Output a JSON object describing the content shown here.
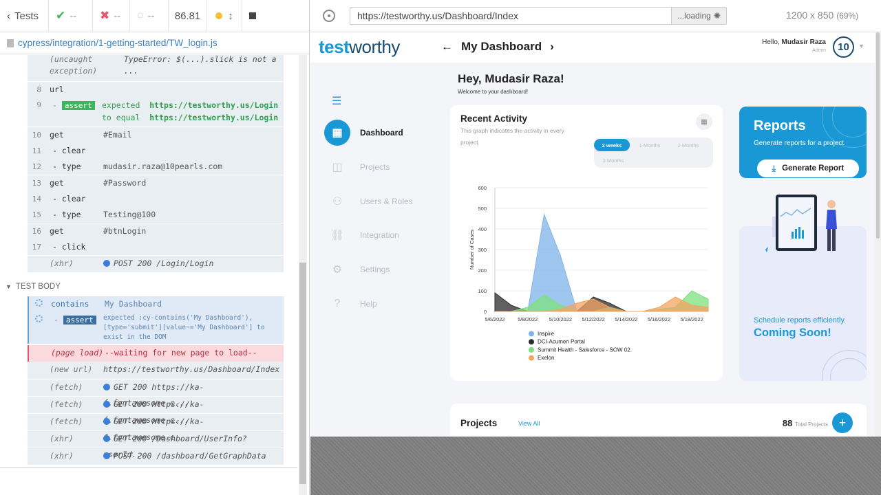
{
  "runner": {
    "tests_label": "Tests",
    "passed": "--",
    "failed": "--",
    "pending": "--",
    "duration": "86.81",
    "spec_path": "cypress/integration/1-getting-started/TW_login.js"
  },
  "commands": [
    {
      "num": "",
      "name": "(uncaught exception)",
      "msg": "TypeError: $(...).slick is not a ..."
    },
    {
      "num": "8",
      "name": "url",
      "msg": ""
    },
    {
      "num": "9",
      "name": "-assert",
      "msg_prefix": "expected",
      "msg_a": "https://testworthy.us/Login",
      "msg_mid": "to equal",
      "msg_b": "https://testworthy.us/Login"
    },
    {
      "num": "10",
      "name": "get",
      "msg": "#Email"
    },
    {
      "num": "11",
      "name": "- clear",
      "msg": ""
    },
    {
      "num": "12",
      "name": "- type",
      "msg": "mudasir.raza@10pearls.com"
    },
    {
      "num": "13",
      "name": "get",
      "msg": "#Password"
    },
    {
      "num": "14",
      "name": "- clear",
      "msg": ""
    },
    {
      "num": "15",
      "name": "- type",
      "msg": "Testing@100"
    },
    {
      "num": "16",
      "name": "get",
      "msg": "#btnLogin"
    },
    {
      "num": "17",
      "name": "- click",
      "msg": ""
    },
    {
      "num": "",
      "name": "(xhr)",
      "msg": "POST 200 /Login/Login"
    }
  ],
  "test_body": {
    "label": "TEST BODY",
    "contains": {
      "name": "contains",
      "msg": "My Dashboard"
    },
    "assert": {
      "name": "-assert",
      "line1": "expected  :cy-contains('My Dashboard'),",
      "line2": "[type='submit'][value~='My Dashboard']  to",
      "line3": "exist in the DOM"
    },
    "page_load": {
      "name": "(page load)",
      "msg": "--waiting for new page to load--"
    },
    "new_url": {
      "name": "(new url)",
      "msg": "https://testworthy.us/Dashboard/Index"
    },
    "requests": [
      {
        "name": "(fetch)",
        "msg": "GET 200 https://ka-f.fontawesome.c..."
      },
      {
        "name": "(fetch)",
        "msg": "GET 200 https://ka-f.fontawesome.c..."
      },
      {
        "name": "(fetch)",
        "msg": "GET 200 https://ka-f.fontawesome.c..."
      },
      {
        "name": "(xhr)",
        "msg": "GET 200 /Dashboard/UserInfo?userId..."
      },
      {
        "name": "(xhr)",
        "msg": "POST 200 /dashboard/GetGraphData"
      }
    ]
  },
  "browser": {
    "url": "https://testworthy.us/Dashboard/Index",
    "loading": "...loading",
    "viewport": "1200 x 850",
    "scale": "(69%)"
  },
  "app": {
    "logo_a": "test",
    "logo_b": "worthy",
    "page_title": "My Dashboard",
    "hello_prefix": "Hello,",
    "user_name": "Mudasir Raza",
    "user_role": "Admin",
    "avatar_text": "10",
    "nav": [
      "Dashboard",
      "Projects",
      "Users & Roles",
      "Integration",
      "Settings",
      "Help"
    ],
    "greeting": "Hey, Mudasir Raza!",
    "welcome": "Welcome to your dashboard!",
    "activity": {
      "title": "Recent Activity",
      "desc": "This graph indicates the activity in every project.",
      "tabs": [
        "2 weeks",
        "1 Months",
        "2 Months",
        "3 Months"
      ]
    },
    "reports": {
      "title": "Reports",
      "subtitle": "Generate reports for a project.",
      "button": "Generate Report"
    },
    "coming_soon": {
      "subtitle": "Schedule reports efficiently.",
      "title": "Coming Soon!"
    },
    "projects": {
      "title": "Projects",
      "view_all": "View All",
      "count": "88",
      "count_label": "Total Projects"
    }
  },
  "chart_data": {
    "type": "area",
    "ylabel": "Number of Cases",
    "xlabel": "",
    "ylim": [
      0,
      600
    ],
    "yticks": [
      0,
      100,
      200,
      300,
      400,
      500,
      600
    ],
    "x": [
      "5/6/2022",
      "5/7/2022",
      "5/8/2022",
      "5/9/2022",
      "5/10/2022",
      "5/11/2022",
      "5/12/2022",
      "5/13/2022",
      "5/14/2022",
      "5/15/2022",
      "5/16/2022",
      "5/17/2022",
      "5/18/2022",
      "5/19/2022"
    ],
    "xticks": [
      "5/6/2022",
      "5/8/2022",
      "5/10/2022",
      "5/12/2022",
      "5/14/2022",
      "5/16/2022",
      "5/18/2022"
    ],
    "series": [
      {
        "name": "Inspire",
        "color": "#7fb3e8",
        "values": [
          0,
          0,
          0,
          470,
          270,
          0,
          0,
          0,
          0,
          0,
          0,
          0,
          0,
          0
        ]
      },
      {
        "name": "DCI-Acumen Portal",
        "color": "#2b2b2b",
        "values": [
          90,
          30,
          0,
          0,
          0,
          0,
          70,
          40,
          0,
          0,
          0,
          0,
          0,
          0
        ]
      },
      {
        "name": "Summit Health - Salesforce - SOW 02.",
        "color": "#7ee07e",
        "values": [
          0,
          0,
          20,
          80,
          30,
          0,
          0,
          20,
          0,
          0,
          10,
          20,
          100,
          60
        ]
      },
      {
        "name": "Exelon",
        "color": "#f4a360",
        "values": [
          0,
          0,
          0,
          0,
          10,
          40,
          60,
          20,
          0,
          0,
          20,
          70,
          30,
          20
        ]
      }
    ]
  }
}
